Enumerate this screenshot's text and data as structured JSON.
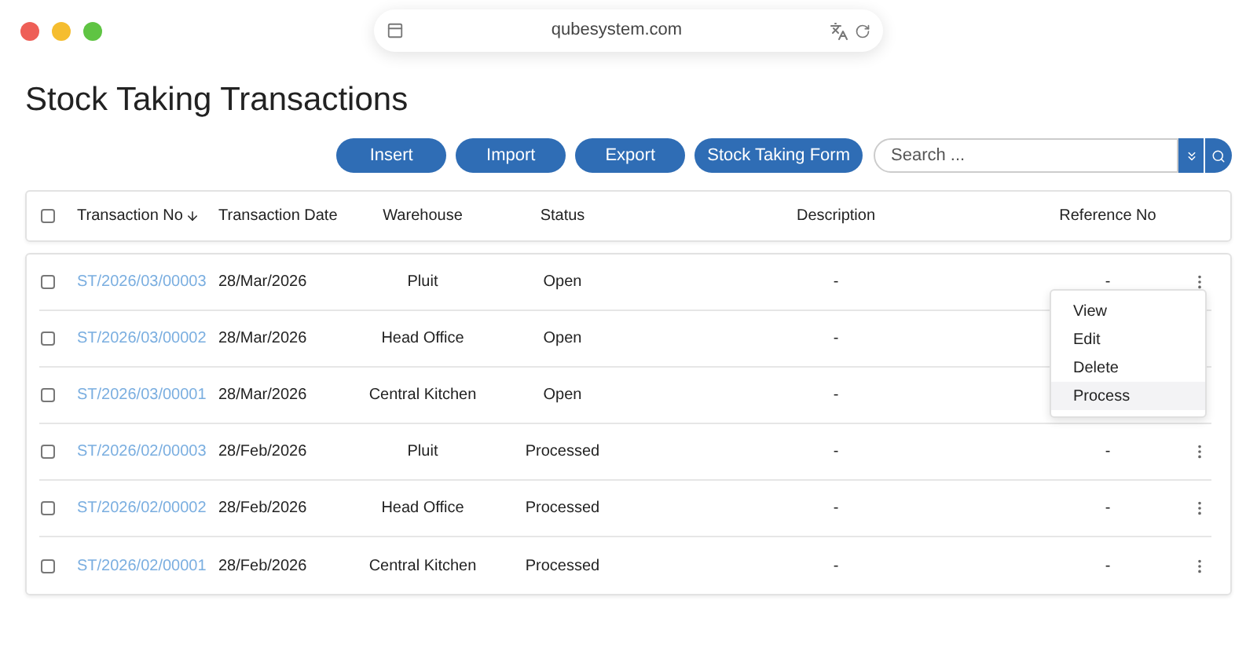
{
  "browser": {
    "url": "qubesystem.com"
  },
  "page_title": "Stock Taking Transactions",
  "toolbar": {
    "buttons": [
      "Insert",
      "Import",
      "Export",
      "Stock Taking Form"
    ],
    "search": {
      "placeholder": "Search ..."
    }
  },
  "table": {
    "select_all": {
      "checked": false
    },
    "columns": [
      {
        "label": "Transaction No",
        "sorted_descending": true
      },
      {
        "label": "Transaction Date",
        "sorted_descending": false
      },
      {
        "label": "Warehouse",
        "sorted_descending": false
      },
      {
        "label": "Status",
        "sorted_descending": false
      },
      {
        "label": "Description",
        "sorted_descending": false
      },
      {
        "label": "Reference No",
        "sorted_descending": false
      }
    ],
    "rows": [
      {
        "checked": false,
        "transaction_no": "ST/2026/03/00003",
        "date": "28/Mar/2026",
        "warehouse": "Pluit",
        "status": "Open",
        "description": "-",
        "reference_no": "-"
      },
      {
        "checked": false,
        "transaction_no": "ST/2026/03/00002",
        "date": "28/Mar/2026",
        "warehouse": "Head Office",
        "status": "Open",
        "description": "-"
      },
      {
        "checked": false,
        "transaction_no": "ST/2026/03/00001",
        "date": "28/Mar/2026",
        "warehouse": "Central Kitchen",
        "status": "Open",
        "description": "-"
      },
      {
        "checked": false,
        "transaction_no": "ST/2026/02/00003",
        "date": "28/Feb/2026",
        "warehouse": "Pluit",
        "status": "Processed",
        "description": "-",
        "reference_no": "-"
      },
      {
        "checked": false,
        "transaction_no": "ST/2026/02/00002",
        "date": "28/Feb/2026",
        "warehouse": "Head Office",
        "status": "Processed",
        "description": "-",
        "reference_no": "-"
      },
      {
        "checked": false,
        "transaction_no": "ST/2026/02/00001",
        "date": "28/Feb/2026",
        "warehouse": "Central Kitchen",
        "status": "Processed",
        "description": "-",
        "reference_no": "-"
      }
    ]
  },
  "row_menu": {
    "items": [
      {
        "label": "View",
        "selected": false
      },
      {
        "label": "Edit",
        "selected": false
      },
      {
        "label": "Delete",
        "selected": false
      },
      {
        "label": "Process",
        "selected": true
      }
    ]
  }
}
